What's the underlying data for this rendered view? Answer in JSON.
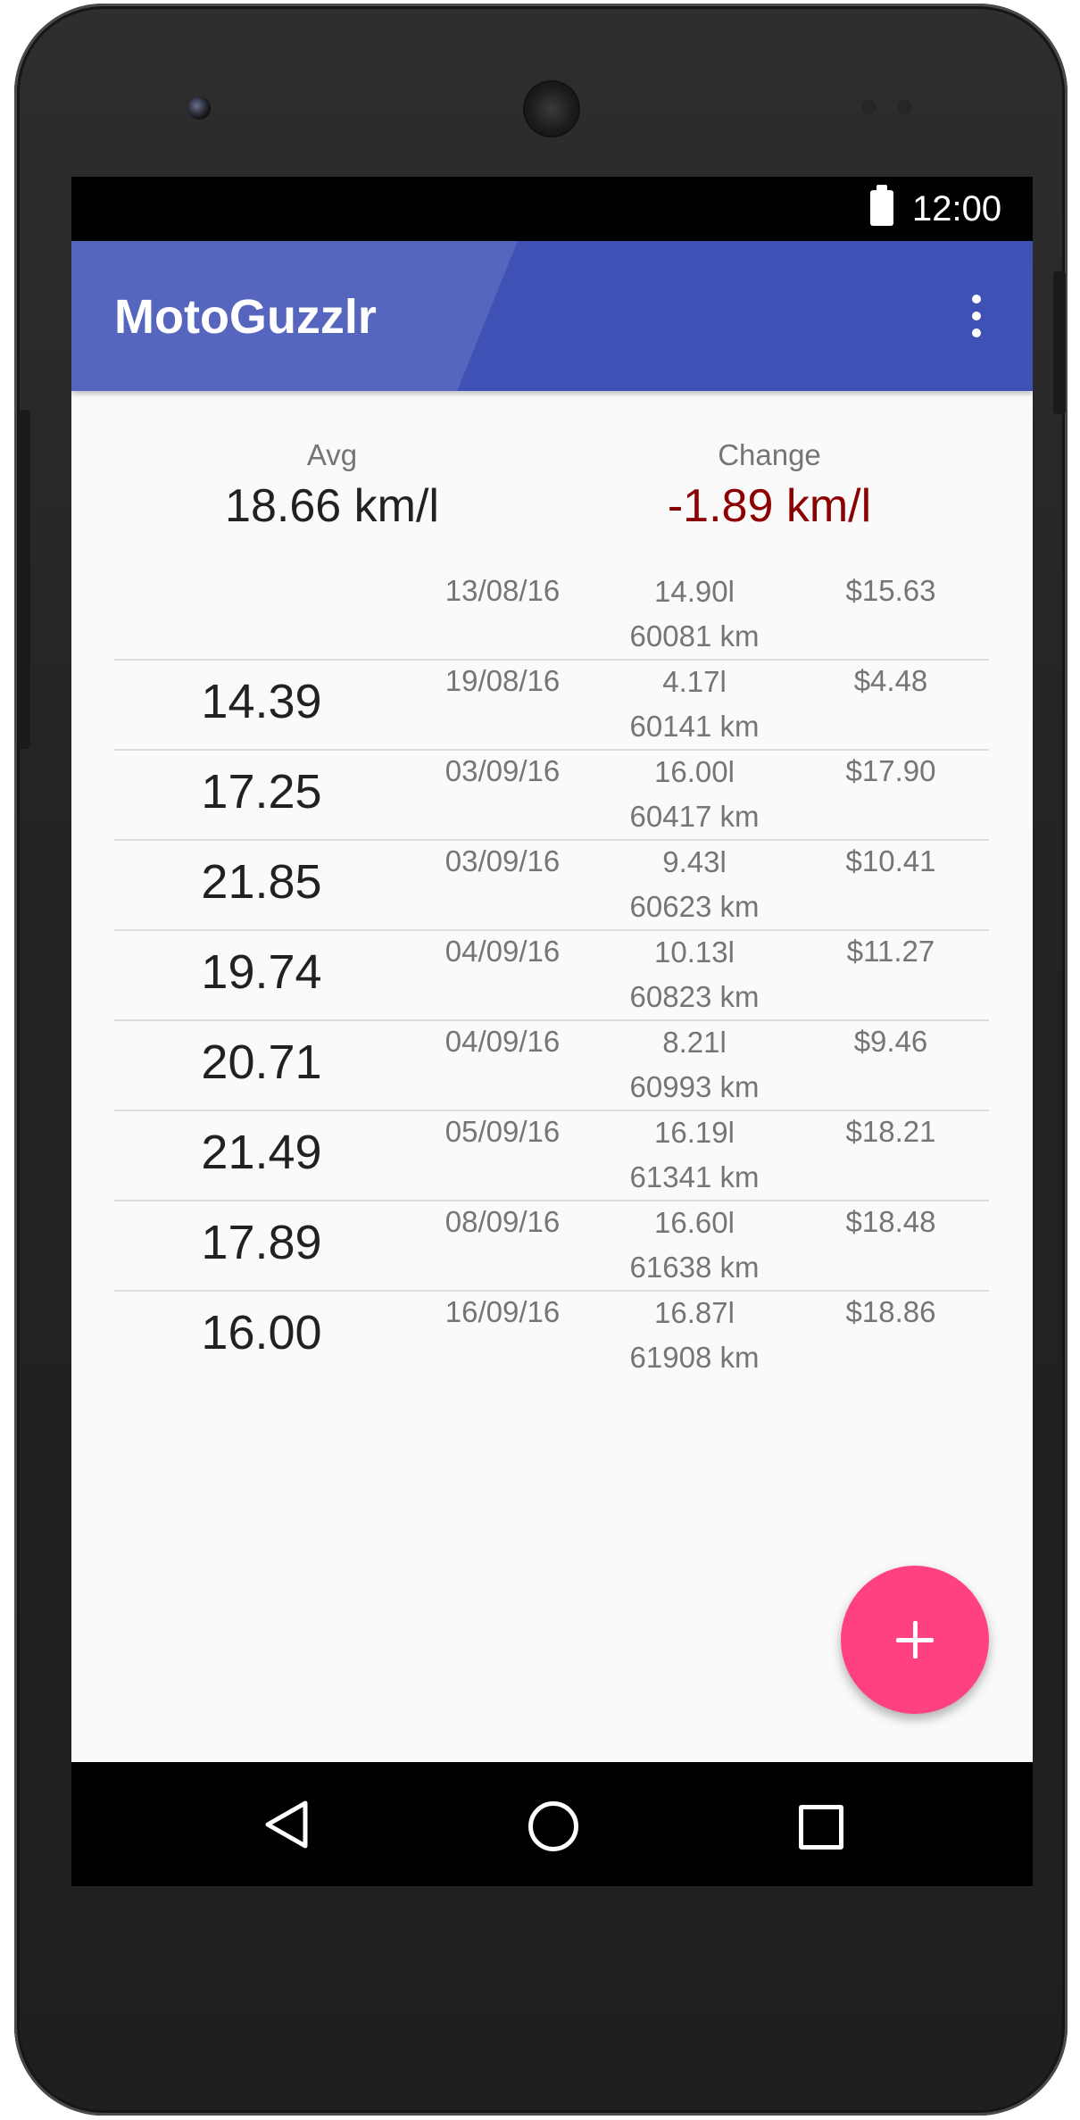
{
  "status_bar": {
    "time": "12:00",
    "battery_icon": "battery-full-icon"
  },
  "app_bar": {
    "title": "MotoGuzzlr",
    "menu_icon": "more-vert-icon",
    "color": "#3f51b5"
  },
  "summary": {
    "avg": {
      "label": "Avg",
      "value": "18.66 km/l",
      "color": "#212121"
    },
    "change": {
      "label": "Change",
      "value": "-1.89 km/l",
      "color": "#8b0000"
    }
  },
  "fillups": [
    {
      "efficiency": "",
      "date": "13/08/16",
      "liters": "14.90l",
      "odometer": "60081 km",
      "price": "$15.63"
    },
    {
      "efficiency": "14.39",
      "date": "19/08/16",
      "liters": "4.17l",
      "odometer": "60141 km",
      "price": "$4.48"
    },
    {
      "efficiency": "17.25",
      "date": "03/09/16",
      "liters": "16.00l",
      "odometer": "60417 km",
      "price": "$17.90"
    },
    {
      "efficiency": "21.85",
      "date": "03/09/16",
      "liters": "9.43l",
      "odometer": "60623 km",
      "price": "$10.41"
    },
    {
      "efficiency": "19.74",
      "date": "04/09/16",
      "liters": "10.13l",
      "odometer": "60823 km",
      "price": "$11.27"
    },
    {
      "efficiency": "20.71",
      "date": "04/09/16",
      "liters": "8.21l",
      "odometer": "60993 km",
      "price": "$9.46"
    },
    {
      "efficiency": "21.49",
      "date": "05/09/16",
      "liters": "16.19l",
      "odometer": "61341 km",
      "price": "$18.21"
    },
    {
      "efficiency": "17.89",
      "date": "08/09/16",
      "liters": "16.60l",
      "odometer": "61638 km",
      "price": "$18.48"
    },
    {
      "efficiency": "16.00",
      "date": "16/09/16",
      "liters": "16.87l",
      "odometer": "61908 km",
      "price": "$18.86"
    }
  ],
  "fab": {
    "icon": "add-icon",
    "color": "#ff4081"
  },
  "nav_bar": {
    "back_icon": "back-icon",
    "home_icon": "home-icon",
    "recents_icon": "recents-icon"
  }
}
